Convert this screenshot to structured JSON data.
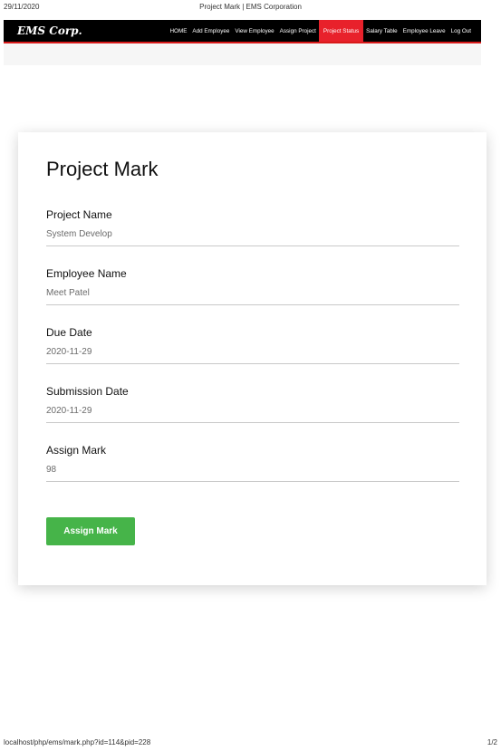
{
  "print_header": {
    "date": "29/11/2020",
    "title": "Project Mark | EMS Corporation"
  },
  "navbar": {
    "brand": "EMS Corp.",
    "items": [
      {
        "label": "HOME"
      },
      {
        "label": "Add Employee"
      },
      {
        "label": "View Employee"
      },
      {
        "label": "Assign Project"
      },
      {
        "label": "Project Status",
        "active": true
      },
      {
        "label": "Salary Table"
      },
      {
        "label": "Employee Leave"
      },
      {
        "label": "Log Out"
      }
    ],
    "active_color": "#e8212b",
    "accent_color": "#d91a1a"
  },
  "form": {
    "title": "Project Mark",
    "fields": [
      {
        "label": "Project Name",
        "value": "System Develop"
      },
      {
        "label": "Employee Name",
        "value": "Meet Patel"
      },
      {
        "label": "Due Date",
        "value": "2020-11-29"
      },
      {
        "label": "Submission Date",
        "value": "2020-11-29"
      },
      {
        "label": "Assign Mark",
        "value": "98"
      }
    ],
    "submit_label": "Assign Mark",
    "submit_color": "#46b449"
  },
  "print_footer": {
    "url": "localhost/php/ems/mark.php?id=114&pid=228",
    "page": "1/2"
  }
}
